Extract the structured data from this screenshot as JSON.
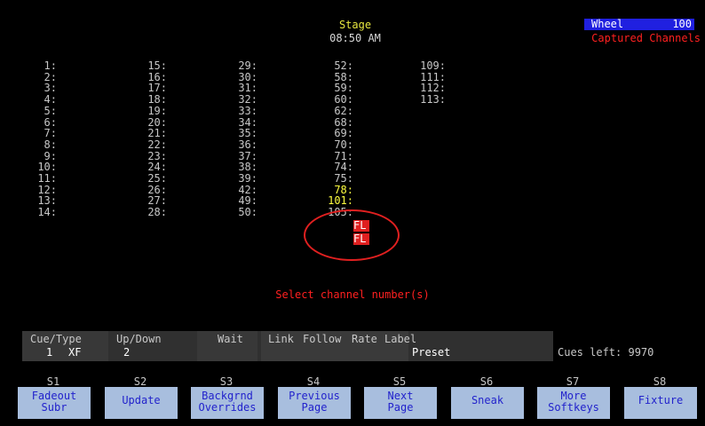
{
  "header": {
    "title": "Stage",
    "time": "08:50 AM"
  },
  "wheel": {
    "label": "Wheel",
    "value": "100"
  },
  "status": {
    "captured": "Captured Channels"
  },
  "channels": [
    [
      "1:",
      "2:",
      "3:",
      "4:",
      "5:",
      "6:",
      "7:",
      "8:",
      "9:",
      "10:",
      "11:",
      "12:",
      "13:",
      "14:"
    ],
    [
      "15:",
      "16:",
      "17:",
      "18:",
      "19:",
      "20:",
      "21:",
      "22:",
      "23:",
      "24:",
      "25:",
      "26:",
      "27:",
      "28:"
    ],
    [
      "29:",
      "30:",
      "31:",
      "32:",
      "33:",
      "34:",
      "35:",
      "36:",
      "37:",
      "38:",
      "39:",
      "42:",
      "49:",
      "50:"
    ],
    [
      "52:",
      "58:",
      "59:",
      "60:",
      "62:",
      "68:",
      "69:",
      "70:",
      "71:",
      "74:",
      "75:",
      "78:",
      "101:",
      "105:"
    ],
    [
      "109:",
      "111:",
      "112:",
      "113:"
    ]
  ],
  "flags": {
    "fl": "FL"
  },
  "prompt": "Select channel number(s)",
  "cue": {
    "headers": [
      "Cue/Type",
      "Up/Down",
      "Wait",
      "Link",
      "Follow",
      "Rate",
      "Label"
    ],
    "cue_number": "1",
    "cue_type": "XF",
    "up_down": "2",
    "label": "Preset",
    "cues_left": "Cues left: 9970"
  },
  "softkeys": [
    {
      "id": "S1",
      "lines": [
        "Fadeout",
        "Subr"
      ]
    },
    {
      "id": "S2",
      "lines": [
        "",
        "Update"
      ]
    },
    {
      "id": "S3",
      "lines": [
        "Backgrnd",
        "Overrides"
      ]
    },
    {
      "id": "S4",
      "lines": [
        "Previous",
        "Page"
      ]
    },
    {
      "id": "S5",
      "lines": [
        "Next",
        "Page"
      ]
    },
    {
      "id": "S6",
      "lines": [
        "",
        "Sneak"
      ]
    },
    {
      "id": "S7",
      "lines": [
        "More",
        "Softkeys"
      ]
    },
    {
      "id": "S8",
      "lines": [
        "",
        "Fixture"
      ]
    }
  ],
  "colors": {
    "background": "#000000",
    "accent_red": "#e02020",
    "softkey_bg": "#a8bede",
    "wheel_bg": "#2020e0"
  }
}
